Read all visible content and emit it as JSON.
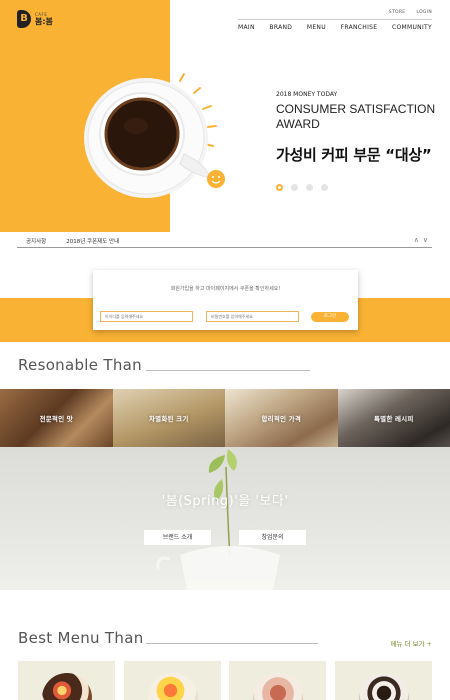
{
  "brand": {
    "logo_letter": "B",
    "cafe": "CAFE",
    "name": "봄:봄"
  },
  "util_nav": [
    "STORE",
    "LOGIN"
  ],
  "gnb": [
    "MAIN",
    "BRAND",
    "MENU",
    "FRANCHISE",
    "COMMUNITY"
  ],
  "hero": {
    "eyebrow": "2018 MONEY TODAY",
    "title": "CONSUMER SATISFACTION AWARD",
    "headline": "가성비 커피 부문 “대상”",
    "slide_count": 4,
    "active_slide": 1
  },
  "notice": {
    "label": "공지사항",
    "text": "2018년 쿠폰제도 안내",
    "up": "∧",
    "down": "∨"
  },
  "coupon": {
    "message": "회원가입을 하고 마이페이지에서 쿠폰을 확인하세요!",
    "id_placeholder": "아이디를 입력해주세요",
    "pw_placeholder": "비밀번호를 입력해주세요",
    "button": "로그인"
  },
  "reasons": {
    "title": "Resonable Than",
    "tiles": [
      "전문적인 맛",
      "차별화된 크기",
      "합리적인 가격",
      "특별한 레시피"
    ]
  },
  "spring": {
    "title": "'봄(Spring)'을 '보다'",
    "brand_button": "브랜드 소개",
    "startup_button": "창업문의"
  },
  "best_menu": {
    "title": "Best Menu Than",
    "more": "메뉴 더 보기 +"
  },
  "colors": {
    "accent": "#f9b233",
    "olive": "#7c8a2b",
    "card_bg": "#efeede"
  }
}
